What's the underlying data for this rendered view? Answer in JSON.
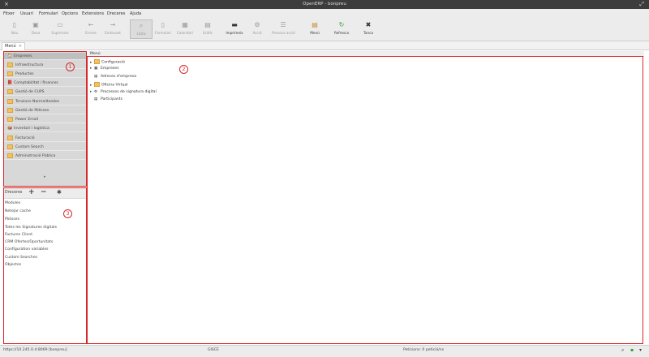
{
  "window": {
    "title": "OpenERP - bonpreu"
  },
  "menubar": [
    "Fitxer",
    "Usuari",
    "Formulari",
    "Opcions",
    "Extensions",
    "Dreceres",
    "Ajuda"
  ],
  "toolbar": [
    {
      "label": "Nou",
      "icon": "new-doc-icon",
      "enabled": false
    },
    {
      "label": "Desa",
      "icon": "save-icon",
      "enabled": false
    },
    {
      "label": "Suprimeix",
      "icon": "delete-icon",
      "enabled": false
    },
    {
      "label": "Enrere",
      "icon": "back-arrow-icon",
      "enabled": false
    },
    {
      "label": "Endavant",
      "icon": "forward-arrow-icon",
      "enabled": false
    },
    {
      "label": "Llista",
      "icon": "search-icon",
      "enabled": false,
      "selected": true
    },
    {
      "label": "Formulari",
      "icon": "form-icon",
      "enabled": false
    },
    {
      "label": "Calendari",
      "icon": "calendar-icon",
      "enabled": false
    },
    {
      "label": "Gràfic",
      "icon": "graph-icon",
      "enabled": false
    },
    {
      "label": "Imprimeix",
      "icon": "print-icon",
      "enabled": true
    },
    {
      "label": "Acció",
      "icon": "action-icon",
      "enabled": false
    },
    {
      "label": "Provoca acció",
      "icon": "trigger-icon",
      "enabled": false
    },
    {
      "label": "Menú",
      "icon": "menu-icon",
      "enabled": true
    },
    {
      "label": "Refresca",
      "icon": "refresh-icon",
      "enabled": true
    },
    {
      "label": "Tanca",
      "icon": "close-icon",
      "enabled": true
    }
  ],
  "tab": {
    "label": "Menú",
    "close": "×"
  },
  "modules": [
    {
      "label": "Empreses",
      "icon": "emo",
      "glyph": "🏠"
    },
    {
      "label": "Infraestructura",
      "icon": "folder"
    },
    {
      "label": "Productes",
      "icon": "folder"
    },
    {
      "label": "Comptabilitat i finances",
      "icon": "emo",
      "glyph": "📕"
    },
    {
      "label": "Gestió de CUPS",
      "icon": "folder"
    },
    {
      "label": "Tensions Normalitzades",
      "icon": "folder"
    },
    {
      "label": "Gestió de Pòlisses",
      "icon": "folder"
    },
    {
      "label": "Power Email",
      "icon": "folder"
    },
    {
      "label": "Inventari i logística",
      "icon": "emo",
      "glyph": "📦"
    },
    {
      "label": "Facturació",
      "icon": "folder"
    },
    {
      "label": "Custom Search",
      "icon": "folder"
    },
    {
      "label": "Administració Pública",
      "icon": "folder"
    }
  ],
  "modules_more": "▸",
  "favs": {
    "title": "Dreceres",
    "add": "+",
    "remove": "−",
    "move": "✱",
    "items": [
      "Modules",
      "Netejar cache",
      "Pòlisses",
      "Totes les Signatures digitals",
      "Factures Client",
      "CRM Ofertes/Oportunitats",
      "Configuration variables",
      "Custom Searches",
      "Objectes"
    ]
  },
  "main": {
    "header": "Menú",
    "tree": [
      {
        "label": "Configuració",
        "arrow": "▸",
        "icon": "folder"
      },
      {
        "label": "Empreses",
        "arrow": "▸",
        "icon": "grid",
        "glyph": "▦"
      },
      {
        "label": "Adreces d'empresa",
        "arrow": "",
        "icon": "grid",
        "glyph": "▤"
      },
      {
        "label": "Oficina Virtual",
        "arrow": "▸",
        "icon": "folder"
      },
      {
        "label": "Processos de signatura digital",
        "arrow": "▸",
        "icon": "gear",
        "glyph": "⚙"
      },
      {
        "label": "Participants",
        "arrow": "",
        "icon": "grid",
        "glyph": "▤"
      }
    ]
  },
  "badges": [
    "1",
    "2",
    "3"
  ],
  "status": {
    "left": "https://10.245.0.4:8069 [bonpreu]",
    "center": "GISCE",
    "right": "Peticions: 0 petició/ns"
  },
  "colors": {
    "highlight": "#d62828",
    "titlebar": "#3c3c3c"
  }
}
